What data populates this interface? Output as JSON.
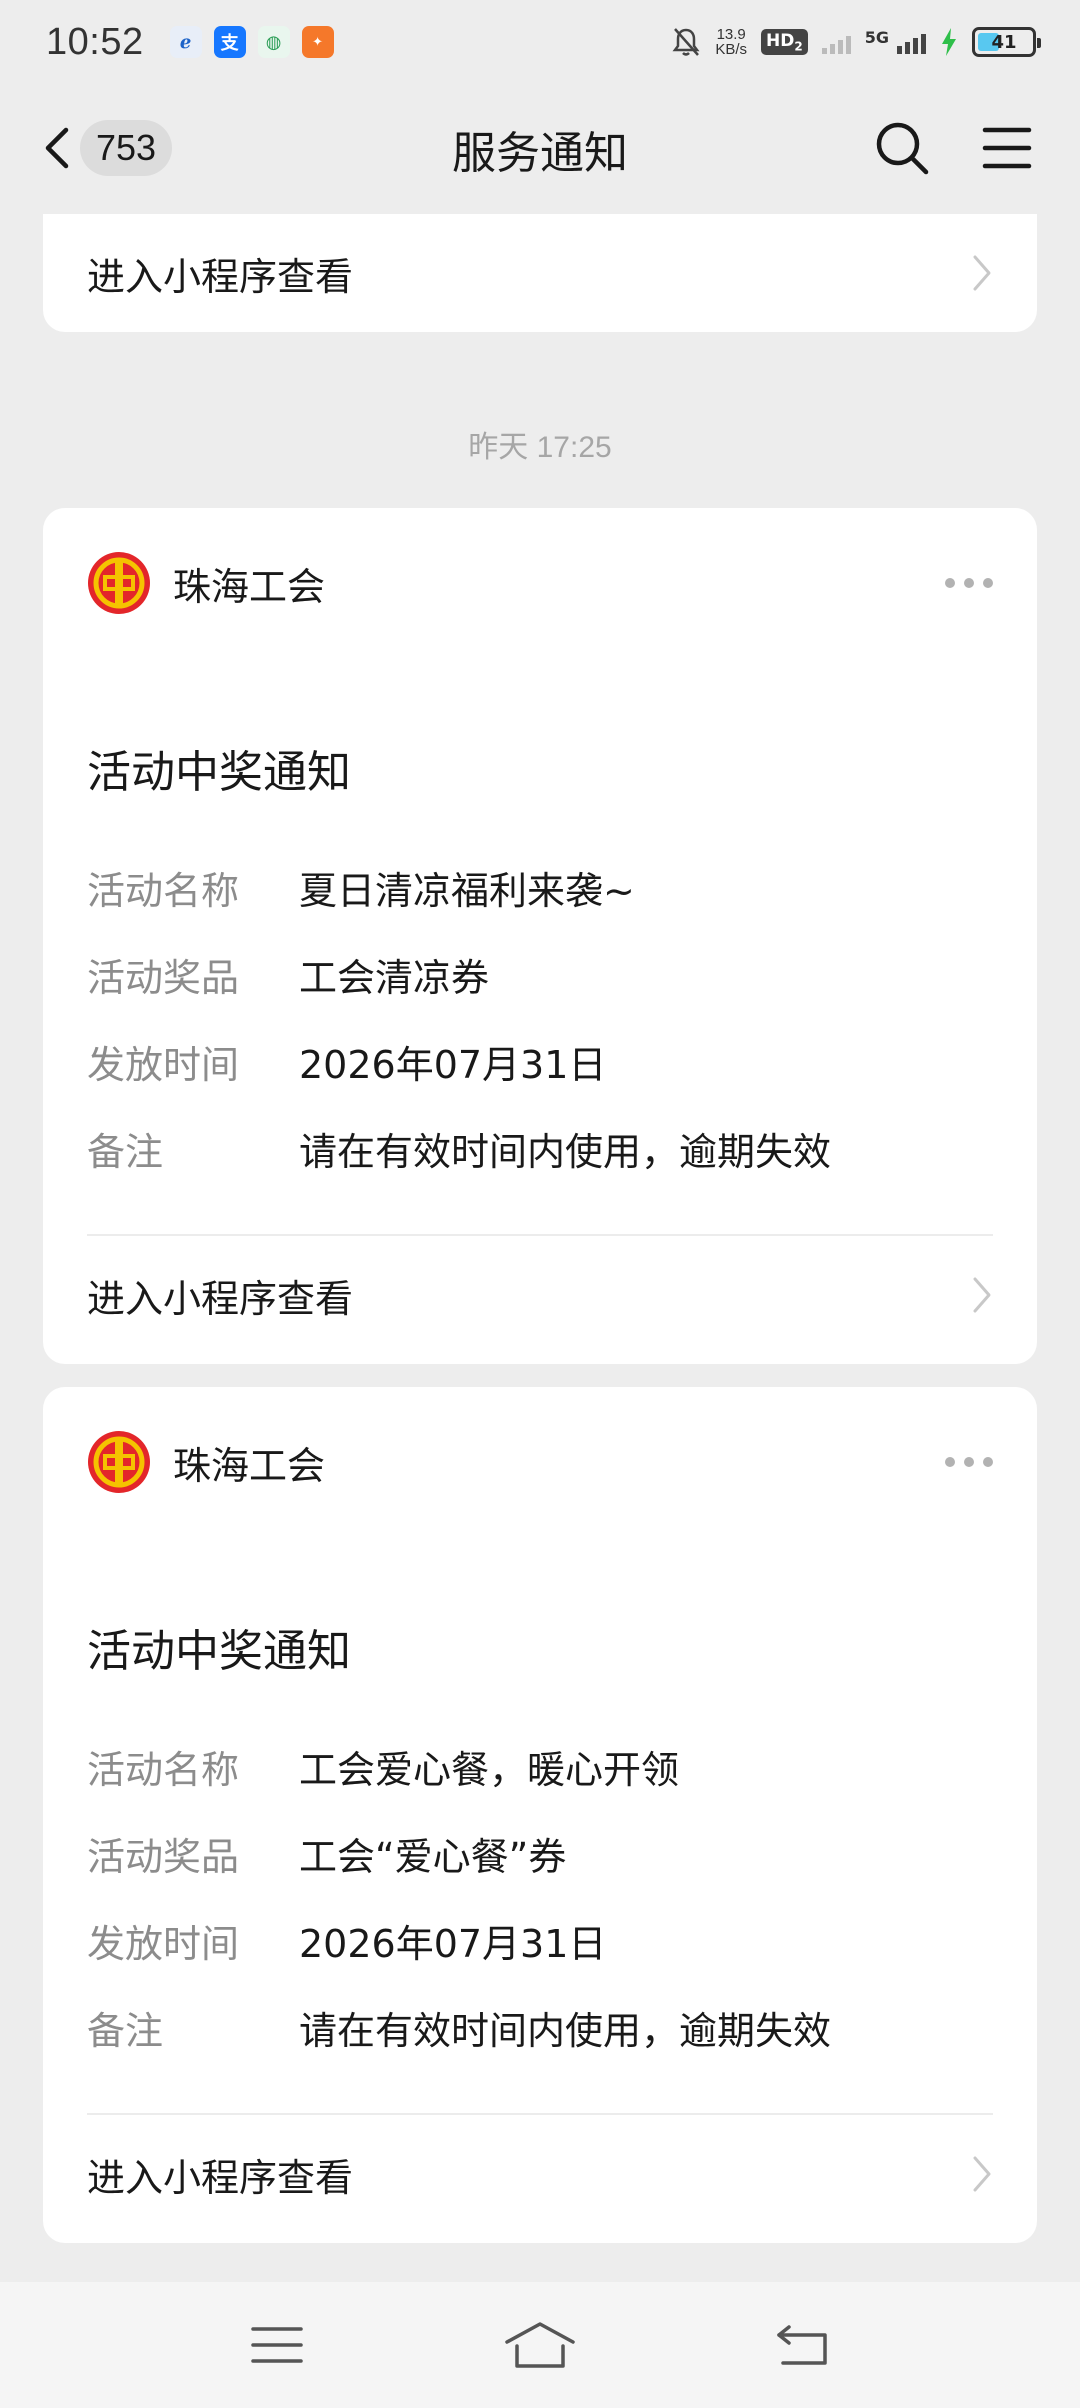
{
  "status_bar": {
    "time": "10:52",
    "net_speed_value": "13.9",
    "net_speed_unit": "KB/s",
    "hd_label": "HD",
    "hd_sub": "2",
    "network_label": "5G",
    "battery": "41",
    "battery_level": 0.41,
    "app_icons": [
      "china-telecom-icon",
      "alipay-icon",
      "app-icon",
      "app-icon"
    ]
  },
  "header": {
    "back_count": "753",
    "title": "服务通知"
  },
  "top_card": {
    "link_label": "进入小程序查看"
  },
  "timestamp": "昨天 17:25",
  "notifications": [
    {
      "sender": "珠海工会",
      "title": "活动中奖通知",
      "fields": [
        {
          "label": "活动名称",
          "value": "夏日清凉福利来袭~"
        },
        {
          "label": "活动奖品",
          "value": "工会清凉券"
        },
        {
          "label": "发放时间",
          "value": "2026年07月31日"
        },
        {
          "label": "备注",
          "value": "请在有效时间内使用，逾期失效"
        }
      ],
      "link_label": "进入小程序查看"
    },
    {
      "sender": "珠海工会",
      "title": "活动中奖通知",
      "fields": [
        {
          "label": "活动名称",
          "value": "工会爱心餐，暖心开领"
        },
        {
          "label": "活动奖品",
          "value": "工会“爱心餐”券"
        },
        {
          "label": "发放时间",
          "value": "2026年07月31日"
        },
        {
          "label": "备注",
          "value": "请在有效时间内使用，逾期失效"
        }
      ],
      "link_label": "进入小程序查看"
    }
  ],
  "colors": {
    "background": "#ededed",
    "card": "#ffffff",
    "logo_red": "#e3262a",
    "logo_yellow": "#f5c300"
  }
}
